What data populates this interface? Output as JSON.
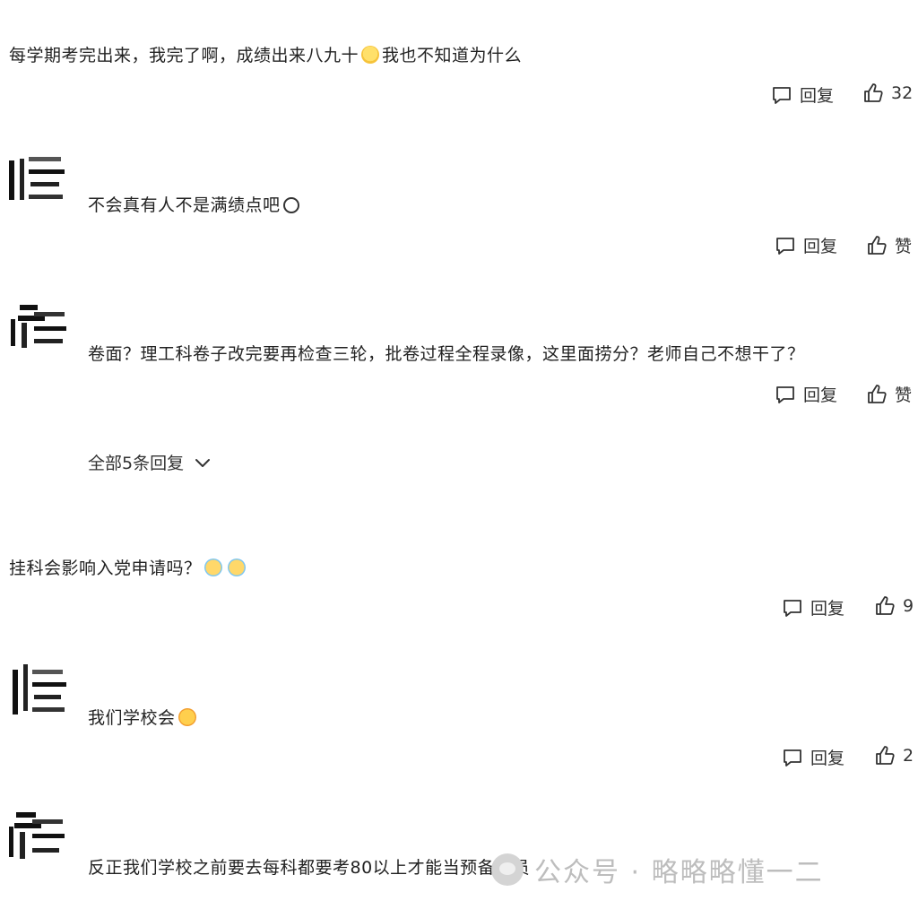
{
  "comments": [
    {
      "text": "每学期考完出来，我完了啊，成绩出来八九十",
      "text2": "我也不知道为什么",
      "reply_label": "回复",
      "like_label": "32"
    },
    {
      "text": "不会真有人不是满绩点吧",
      "reply_label": "回复",
      "like_label": "赞"
    },
    {
      "text": "卷面？理工科卷子改完要再检查三轮，批卷过程全程录像，这里面捞分？老师自己不想干了？",
      "reply_label": "回复",
      "like_label": "赞"
    },
    {
      "text": "挂科会影响入党申请吗？",
      "reply_label": "回复",
      "like_label": "9"
    },
    {
      "text": "我们学校会",
      "reply_label": "回复",
      "like_label": "2"
    },
    {
      "text": "反正我们学校之前要去每科都要考80以上才能当预备党员"
    }
  ],
  "expand_replies_label": "全部5条回复",
  "watermark": {
    "text": "公众号 · 略略略懂一二"
  },
  "icons": {
    "reply": "comment-bubble-icon",
    "like": "thumbs-up-icon",
    "expand": "chevron-down-icon"
  }
}
